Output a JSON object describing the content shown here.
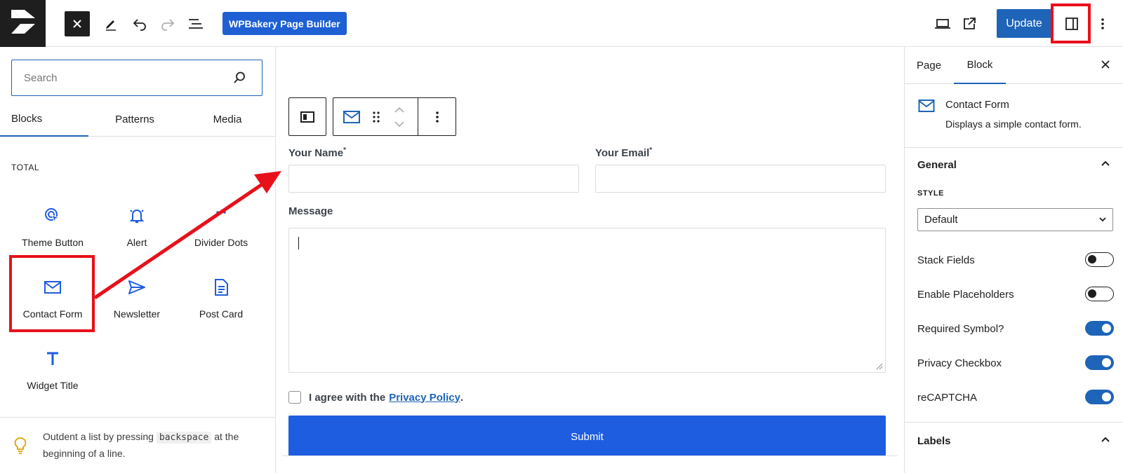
{
  "topbar": {
    "page_builder_label": "WPBakery Page Builder",
    "update_label": "Update"
  },
  "inserter": {
    "search_placeholder": "Search",
    "tabs": [
      {
        "label": "Blocks",
        "active": true
      },
      {
        "label": "Patterns",
        "active": false
      },
      {
        "label": "Media",
        "active": false
      }
    ],
    "category": "TOTAL",
    "blocks": [
      {
        "label": "Theme Button",
        "icon": "cursor-click-icon"
      },
      {
        "label": "Alert",
        "icon": "bell-icon"
      },
      {
        "label": "Divider Dots",
        "icon": "dots-icon"
      },
      {
        "label": "Contact Form",
        "icon": "envelope-icon"
      },
      {
        "label": "Newsletter",
        "icon": "paper-plane-icon"
      },
      {
        "label": "Post Card",
        "icon": "document-icon"
      },
      {
        "label": "Widget Title",
        "icon": "text-t-icon"
      }
    ],
    "tip": {
      "before": "Outdent a list by pressing ",
      "key": "backspace",
      "after": " at the beginning of a line."
    }
  },
  "canvas": {
    "form": {
      "name_label": "Your Name",
      "email_label": "Your Email",
      "required_mark": "*",
      "message_label": "Message",
      "agree_text": "I agree with the",
      "privacy_link": "Privacy Policy",
      "agree_suffix": ".",
      "submit_label": "Submit"
    }
  },
  "sidebar": {
    "tabs": [
      {
        "label": "Page",
        "active": false
      },
      {
        "label": "Block",
        "active": true
      }
    ],
    "block_card": {
      "title": "Contact Form",
      "description": "Displays a simple contact form."
    },
    "general": {
      "title": "General",
      "style_label": "STYLE",
      "style_value": "Default",
      "toggles": [
        {
          "label": "Stack Fields",
          "on": false
        },
        {
          "label": "Enable Placeholders",
          "on": false
        },
        {
          "label": "Required Symbol?",
          "on": true
        },
        {
          "label": "Privacy Checkbox",
          "on": true
        },
        {
          "label": "reCAPTCHA",
          "on": true
        }
      ]
    },
    "labels_title": "Labels"
  },
  "colors": {
    "accent": "#1e64b8",
    "submit": "#1e5ddf",
    "highlight": "#e8101a"
  }
}
